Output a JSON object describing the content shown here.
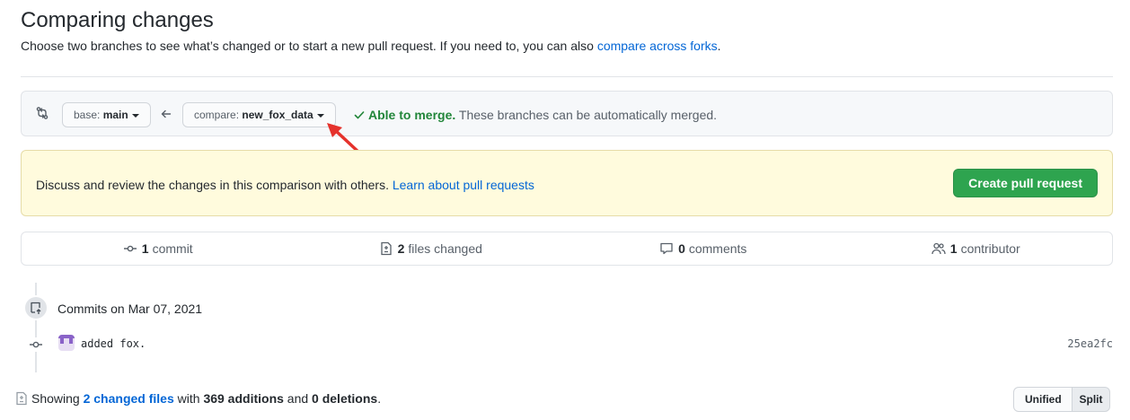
{
  "header": {
    "title": "Comparing changes",
    "description": "Choose two branches to see what’s changed or to start a new pull request. If you need to, you can also ",
    "description_link": "compare across forks",
    "description_end": "."
  },
  "range": {
    "base_prefix": "base: ",
    "base_branch": "main",
    "compare_prefix": "compare: ",
    "compare_branch": "new_fox_data",
    "merge_status": "Able to merge.",
    "merge_detail": " These branches can be automatically merged."
  },
  "flash": {
    "text": "Discuss and review the changes in this comparison with others. ",
    "link": "Learn about pull requests",
    "button": "Create pull request"
  },
  "summary": {
    "commits_count": "1",
    "commits_label": "commit",
    "files_count": "2",
    "files_label": "files changed",
    "comments_count": "0",
    "comments_label": "comments",
    "contributors_count": "1",
    "contributors_label": "contributor"
  },
  "commits": {
    "date_heading": "Commits on Mar 07, 2021",
    "items": [
      {
        "message": "added fox.",
        "sha": "25ea2fc"
      }
    ]
  },
  "diff_summary": {
    "prefix": "Showing ",
    "files_link": "2 changed files",
    "with": " with ",
    "additions": "369 additions",
    "and": " and ",
    "deletions": "0 deletions",
    "end": "."
  },
  "view_toggle": {
    "unified": "Unified",
    "split": "Split",
    "selected": "Split"
  },
  "colors": {
    "link": "#0366d6",
    "success": "#22863a",
    "primary_button": "#2ea44f",
    "flash_bg": "#fffbdd",
    "annotation_arrow": "#e5322c"
  },
  "icons": {
    "compare": "git-compare-icon",
    "arrow_left": "arrow-left-icon",
    "check": "check-icon",
    "commit": "git-commit-icon",
    "file_diff": "file-diff-icon",
    "comment": "comment-icon",
    "people": "people-icon",
    "repo_push": "repo-push-icon"
  }
}
